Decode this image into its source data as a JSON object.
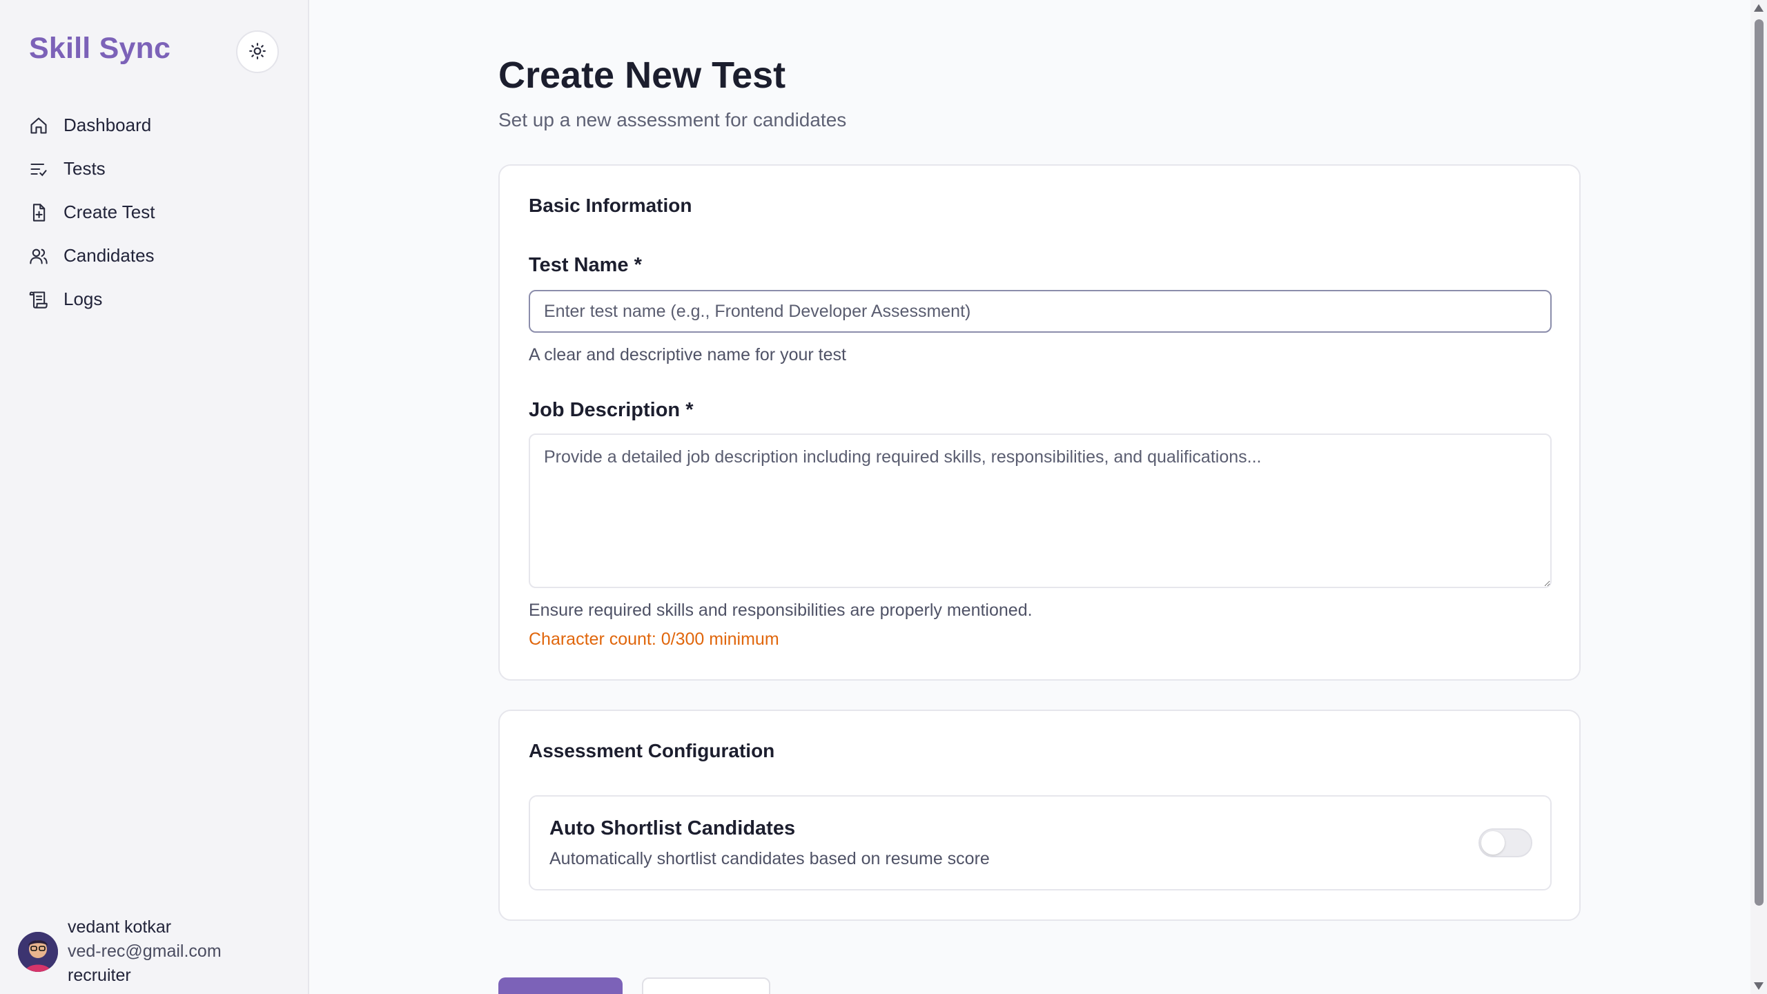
{
  "sidebar": {
    "brand": "Skill Sync",
    "theme_icon": "sun-icon",
    "items": [
      {
        "label": "Dashboard",
        "icon": "home-icon"
      },
      {
        "label": "Tests",
        "icon": "list-check-icon"
      },
      {
        "label": "Create Test",
        "icon": "file-plus-icon"
      },
      {
        "label": "Candidates",
        "icon": "users-icon"
      },
      {
        "label": "Logs",
        "icon": "scroll-icon"
      }
    ],
    "user": {
      "name": "vedant kotkar",
      "email": "ved-rec@gmail.com",
      "role": "recruiter"
    }
  },
  "main": {
    "title": "Create New Test",
    "subtitle": "Set up a new assessment for candidates",
    "basic_info": {
      "title": "Basic Information",
      "test_name_label": "Test Name *",
      "test_name_value": "",
      "test_name_placeholder": "Enter test name (e.g., Frontend Developer Assessment)",
      "test_name_help": "A clear and descriptive name for your test",
      "job_desc_label": "Job Description *",
      "job_desc_value": "",
      "job_desc_placeholder": "Provide a detailed job description including required skills, responsibilities, and qualifications...",
      "job_desc_help": "Ensure required skills and responsibilities are properly mentioned.",
      "char_count": "Character count: 0/300 minimum"
    },
    "assessment": {
      "title": "Assessment Configuration",
      "auto_shortlist_title": "Auto Shortlist Candidates",
      "auto_shortlist_desc": "Automatically shortlist candidates based on resume score",
      "auto_shortlist_enabled": false
    }
  },
  "colors": {
    "brand": "#7c62b8",
    "warning": "#e0660c",
    "background": "#f9fafc",
    "sidebar": "#f4f4f7"
  }
}
